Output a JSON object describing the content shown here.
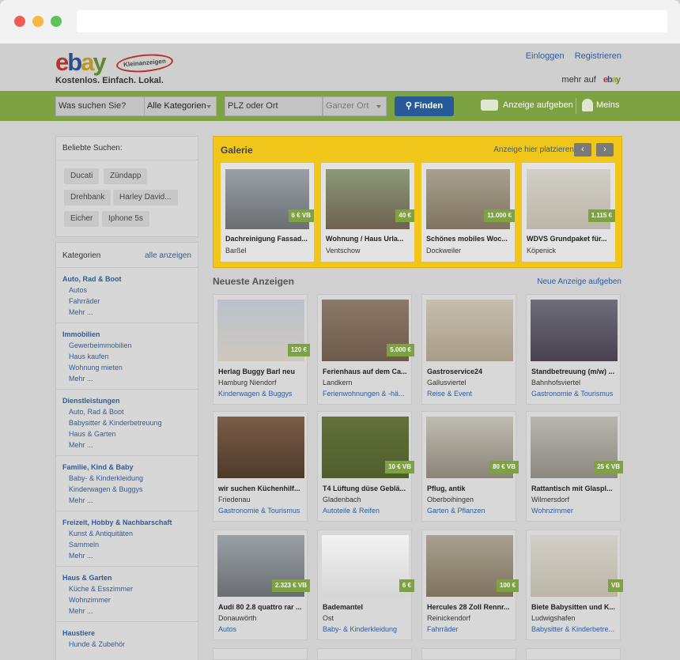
{
  "header": {
    "login": "Einloggen",
    "register": "Registrieren",
    "tagline": "Kostenlos. Einfach. Lokal.",
    "mehr_auf": "mehr auf",
    "logo_sub": "Kleinanzeigen"
  },
  "search": {
    "query_placeholder": "Was suchen Sie?",
    "category": "Alle Kategorien",
    "location_placeholder": "PLZ oder Ort",
    "radius": "Ganzer Ort",
    "find": "Finden",
    "post_ad": "Anzeige aufgeben",
    "mine": "Meins"
  },
  "popular": {
    "title": "Beliebte Suchen:",
    "chips": [
      "Ducati",
      "Zündapp",
      "Drehbank",
      "Harley David...",
      "Eicher",
      "Iphone 5s"
    ]
  },
  "categories": {
    "title": "Kategorien",
    "show_all": "alle anzeigen",
    "groups": [
      {
        "name": "Auto, Rad & Boot",
        "subs": [
          "Autos",
          "Fahrräder",
          "Mehr ..."
        ]
      },
      {
        "name": "Immobilien",
        "subs": [
          "Gewerbeimmobilien",
          "Haus kaufen",
          "Wohnung mieten",
          "Mehr ..."
        ]
      },
      {
        "name": "Dienstleistungen",
        "subs": [
          "Auto, Rad & Boot",
          "Babysitter & Kinderbetreuung",
          "Haus & Garten",
          "Mehr ..."
        ]
      },
      {
        "name": "Familie, Kind & Baby",
        "subs": [
          "Baby- & Kinderkleidung",
          "Kinderwagen & Buggys",
          "Mehr ..."
        ]
      },
      {
        "name": "Freizeit, Hobby & Nachbarschaft",
        "subs": [
          "Kunst & Antiquitäten",
          "Sammeln",
          "Mehr ..."
        ]
      },
      {
        "name": "Haus & Garten",
        "subs": [
          "Küche & Esszimmer",
          "Wohnzimmer",
          "Mehr ..."
        ]
      },
      {
        "name": "Haustiere",
        "subs": [
          "Hunde & Zubehör"
        ]
      }
    ]
  },
  "gallery": {
    "title": "Galerie",
    "place_here": "Anzeige hier platzieren",
    "prev": "‹",
    "next": "›",
    "items": [
      {
        "title": "Dachreinigung Fassad...",
        "location": "Barßel",
        "price": "6 € VB"
      },
      {
        "title": "Wohnung / Haus Urla...",
        "location": "Ventschow",
        "price": "40 €"
      },
      {
        "title": "Schönes mobiles Woc...",
        "location": "Dockweiler",
        "price": "11.000 €"
      },
      {
        "title": "WDVS Grundpaket für...",
        "location": "Köpenick",
        "price": "1.115 €"
      }
    ]
  },
  "newest": {
    "title": "Neueste Anzeigen",
    "new_ad": "Neue Anzeige aufgeben",
    "items": [
      {
        "title": "Herlag Buggy Barl neu",
        "location": "Hamburg Niendorf",
        "category": "Kinderwagen & Buggys",
        "price": "120 €"
      },
      {
        "title": "Ferienhaus auf dem Ca...",
        "location": "Landkern",
        "category": "Ferienwohnungen & -hä...",
        "price": "5.000 €"
      },
      {
        "title": "Gastroservice24",
        "location": "Gallusviertel",
        "category": "Reise & Event",
        "price": ""
      },
      {
        "title": "Standbetreuung (m/w) ...",
        "location": "Bahnhofsviertel",
        "category": "Gastronomie & Tourismus",
        "price": ""
      },
      {
        "title": "wir suchen Küchenhilf...",
        "location": "Friedenau",
        "category": "Gastronomie & Tourismus",
        "price": ""
      },
      {
        "title": "T4 Lüftung düse Geblä...",
        "location": "Gladenbach",
        "category": "Autoteile & Reifen",
        "price": "10 € VB"
      },
      {
        "title": "Pflug, antik",
        "location": "Oberboihingen",
        "category": "Garten & Pflanzen",
        "price": "80 € VB"
      },
      {
        "title": "Rattantisch mit Glaspl...",
        "location": "Wilmersdorf",
        "category": "Wohnzimmer",
        "price": "25 € VB"
      },
      {
        "title": "Audi 80 2.8 quattro rar ...",
        "location": "Donauwörth",
        "category": "Autos",
        "price": "2.323 € VB"
      },
      {
        "title": "Bademantel",
        "location": "Ost",
        "category": "Baby- & Kinderkleidung",
        "price": "6 €"
      },
      {
        "title": "Hercules 28 Zoll Rennr...",
        "location": "Reinickendorf",
        "category": "Fahrräder",
        "price": "100 €"
      },
      {
        "title": "Biete Babysitten und K...",
        "location": "Ludwigshafen",
        "category": "Babysitter & Kinderbetre...",
        "price": "VB"
      }
    ]
  }
}
